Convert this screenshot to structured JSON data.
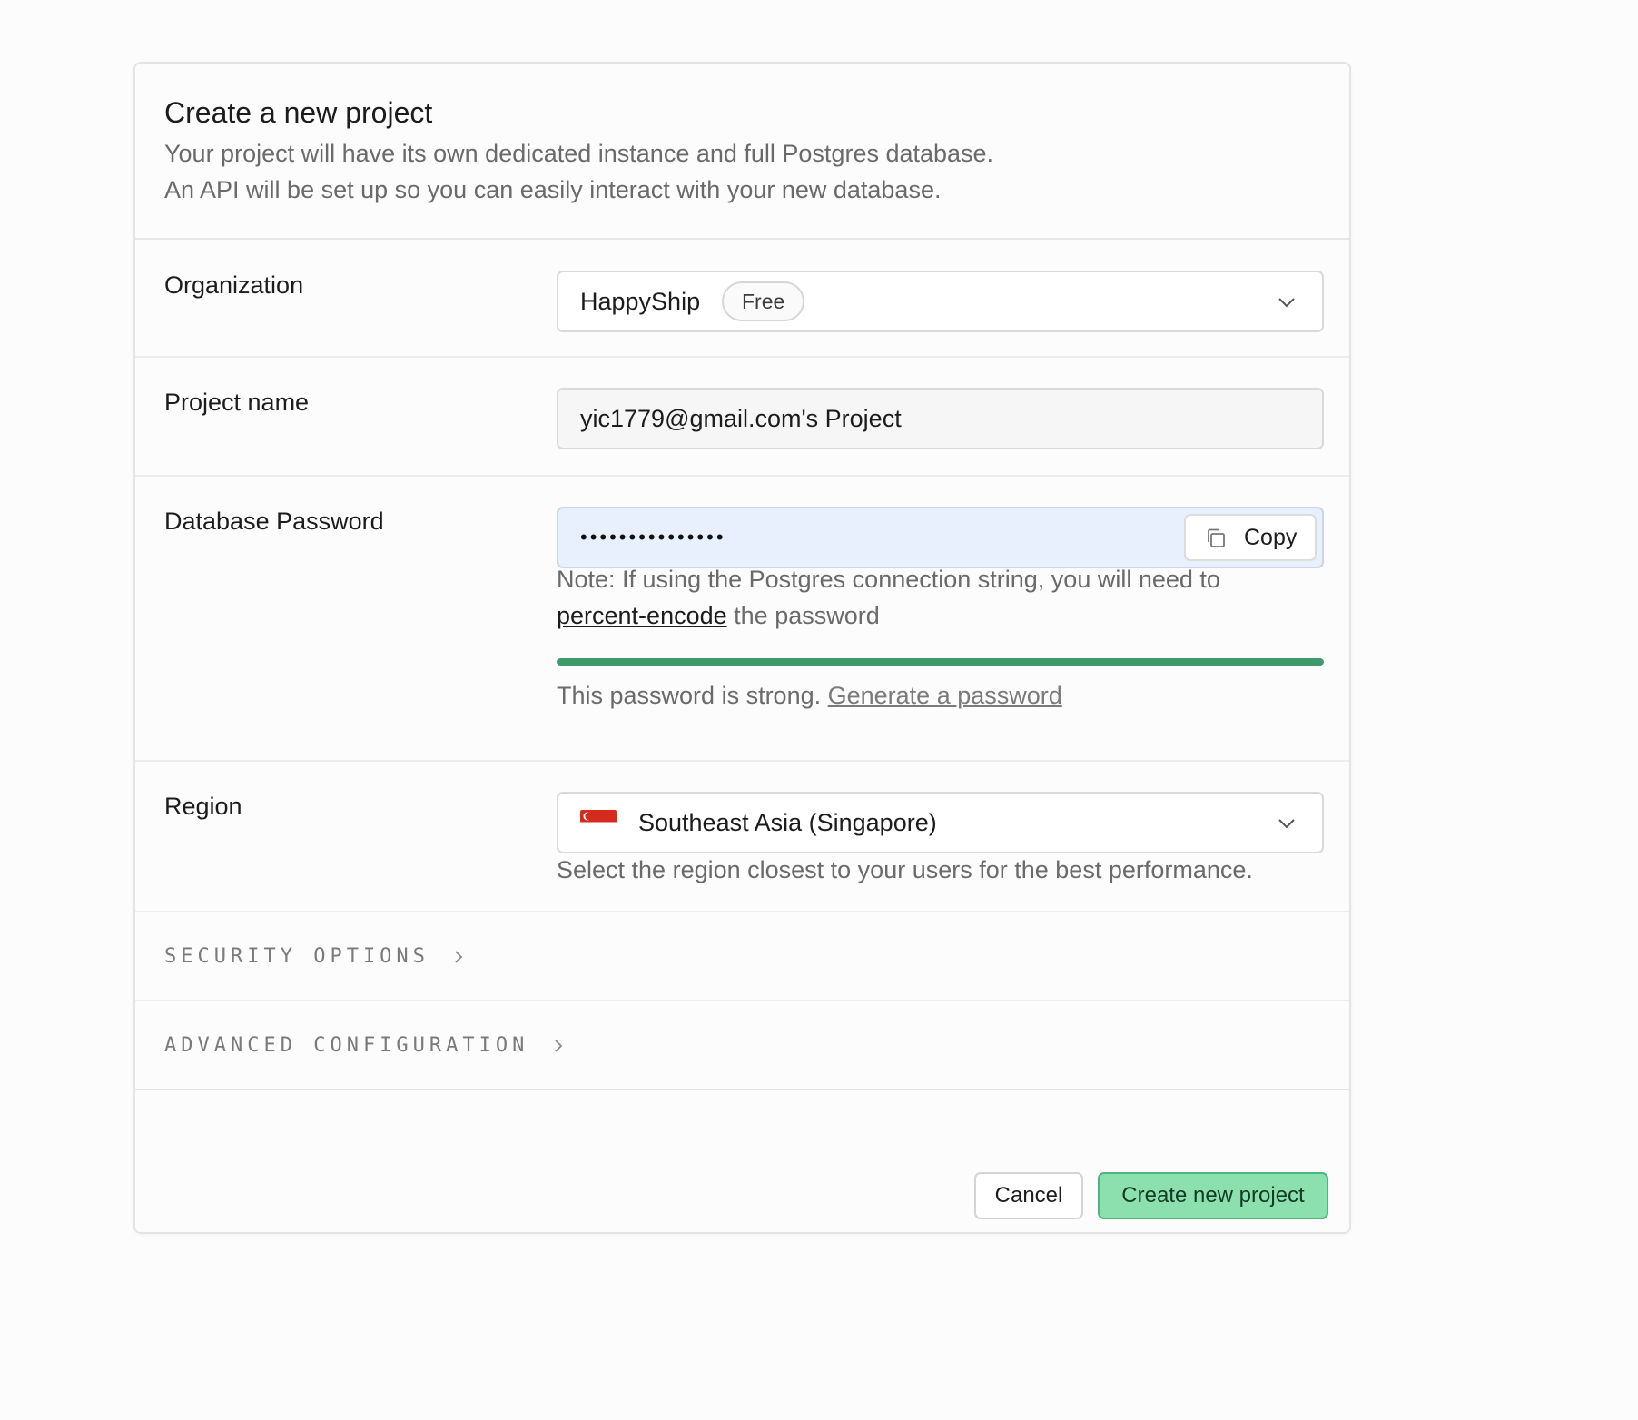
{
  "header": {
    "title": "Create a new project",
    "description_line1": "Your project will have its own dedicated instance and full Postgres database.",
    "description_line2": "An API will be set up so you can easily interact with your new database."
  },
  "organization": {
    "label": "Organization",
    "value": "HappyShip",
    "plan_badge": "Free"
  },
  "project_name": {
    "label": "Project name",
    "value": "yic1779@gmail.com's Project"
  },
  "database_password": {
    "label": "Database Password",
    "masked_value": "•••••••••••••••",
    "copy_label": "Copy",
    "note_prefix": "Note: If using the Postgres connection string, you will need to",
    "note_link": "percent-encode",
    "note_suffix": "the password",
    "strength_text": "This password is strong.",
    "generate_link": "Generate a password",
    "strength_fraction": 1.0,
    "strength_color": "#3f9a6b"
  },
  "region": {
    "label": "Region",
    "value": "Southeast Asia (Singapore)",
    "flag_icon": "singapore-flag-icon",
    "help": "Select the region closest to your users for the best performance."
  },
  "sections": {
    "security": "SECURITY OPTIONS",
    "advanced": "ADVANCED CONFIGURATION"
  },
  "footer": {
    "cancel_label": "Cancel",
    "create_label": "Create new project"
  },
  "colors": {
    "accent": "#8ce0ae",
    "accent_border": "#4fb57f",
    "password_field_bg": "#e8f0fe"
  }
}
